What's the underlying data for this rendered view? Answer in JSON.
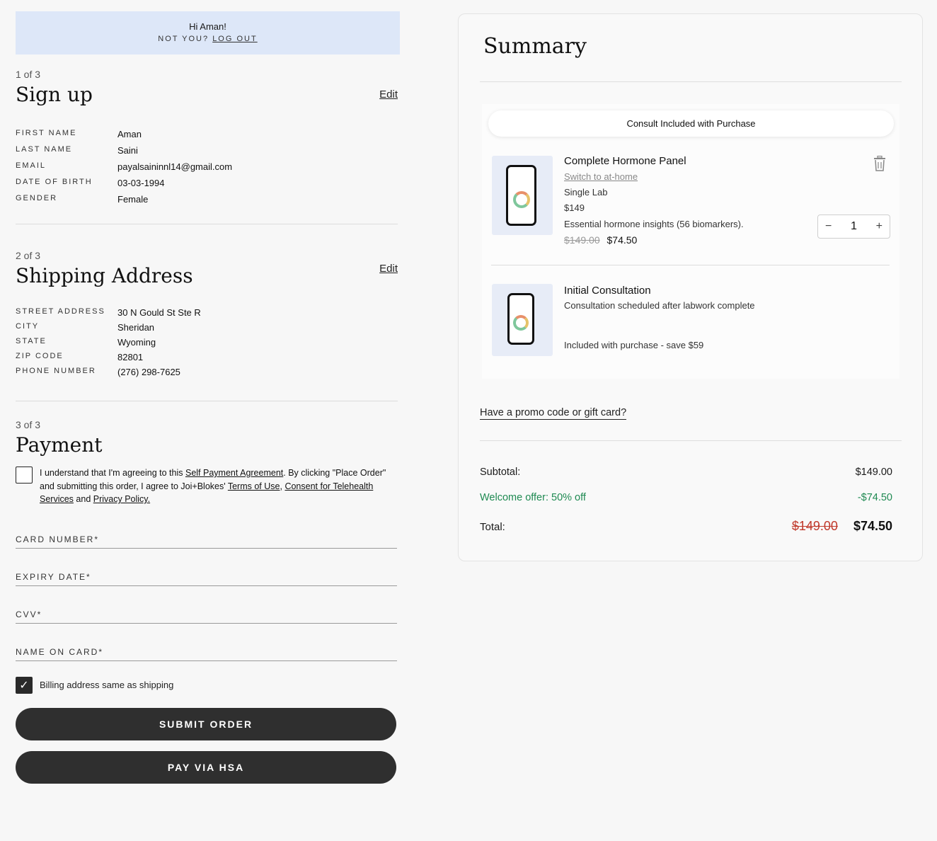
{
  "greeting": {
    "hello": "Hi Aman!",
    "not_you": "NOT YOU?",
    "logout": "LOG OUT"
  },
  "signup": {
    "step": "1 of 3",
    "title": "Sign up",
    "edit": "Edit",
    "fields": [
      {
        "label": "FIRST NAME",
        "value": "Aman"
      },
      {
        "label": "LAST NAME",
        "value": "Saini"
      },
      {
        "label": "EMAIL",
        "value": "payalsaininnl14@gmail.com"
      },
      {
        "label": "DATE OF BIRTH",
        "value": "03-03-1994"
      },
      {
        "label": "GENDER",
        "value": "Female"
      }
    ]
  },
  "shipping": {
    "step": "2 of 3",
    "title": "Shipping Address",
    "edit": "Edit",
    "fields": [
      {
        "label": "STREET ADDRESS",
        "value": "30 N Gould St Ste R"
      },
      {
        "label": "CITY",
        "value": "Sheridan"
      },
      {
        "label": "STATE",
        "value": "Wyoming"
      },
      {
        "label": "ZIP CODE",
        "value": "82801"
      },
      {
        "label": "PHONE NUMBER",
        "value": "(276) 298-7625"
      }
    ]
  },
  "payment": {
    "step": "3 of 3",
    "title": "Payment",
    "agreement": {
      "t1": "I understand that I'm agreeing to this ",
      "link1": "Self Payment Agreement",
      "t2": ". By clicking \"Place Order\" and submitting this order, I agree to Joi+Blokes' ",
      "link2": "Terms of Use",
      "t3": ", ",
      "link3": "Consent for Telehealth Services",
      "t4": " and ",
      "link4": "Privacy Policy."
    },
    "card_number_placeholder": "CARD NUMBER*",
    "expiry_placeholder": "EXPIRY DATE*",
    "cvv_placeholder": "CVV*",
    "name_placeholder": "NAME ON CARD*",
    "billing_label": "Billing address same as shipping",
    "submit_label": "SUBMIT ORDER",
    "hsa_label": "PAY VIA HSA"
  },
  "summary": {
    "title": "Summary",
    "consult_banner": "Consult Included with Purchase",
    "item1": {
      "name": "Complete Hormone Panel",
      "switch_link": "Switch to at-home",
      "type": "Single Lab",
      "price": "$149",
      "description": "Essential hormone insights (56 biomarkers).",
      "old_price": "$149.00",
      "new_price": "$74.50",
      "quantity": "1",
      "minus": "−",
      "plus": "+"
    },
    "item2": {
      "name": "Initial Consultation",
      "subtitle": "Consultation scheduled after labwork complete",
      "note": "Included with purchase - save $59"
    },
    "promo_link": "Have a promo code or gift card?",
    "subtotal_label": "Subtotal:",
    "subtotal_value": "$149.00",
    "offer_label": "Welcome offer: 50% off",
    "offer_value": "-$74.50",
    "total_label": "Total:",
    "total_old": "$149.00",
    "total_new": "$74.50"
  }
}
